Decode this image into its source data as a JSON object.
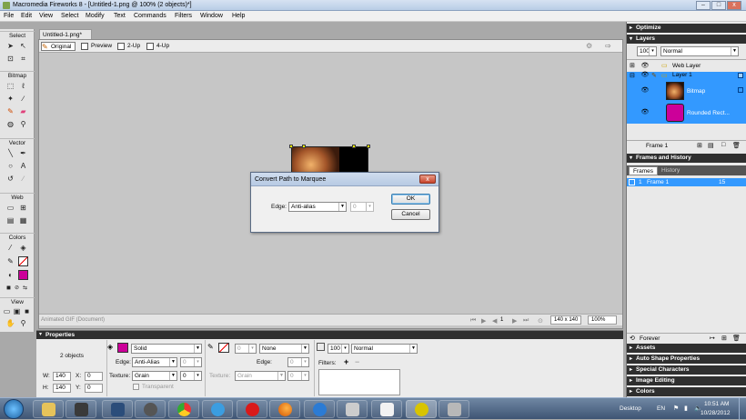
{
  "window": {
    "title": "Macromedia Fireworks 8 - [Untitled-1.png @ 100% (2 objects)*]"
  },
  "menu": [
    "File",
    "Edit",
    "View",
    "Select",
    "Modify",
    "Text",
    "Commands",
    "Filters",
    "Window",
    "Help"
  ],
  "tools": {
    "sections": [
      "Select",
      "Bitmap",
      "Vector",
      "Web",
      "Colors",
      "View"
    ]
  },
  "document": {
    "tab": "Untitled-1.png*",
    "views": [
      "Original",
      "Preview",
      "2-Up",
      "4-Up"
    ],
    "status_left": "Animated GIF (Document)",
    "frame_num": "1",
    "dimensions": "140 x 140",
    "zoom": "100%"
  },
  "dialog": {
    "title": "Convert Path to Marquee",
    "edge_label": "Edge:",
    "edge_value": "Anti-alias",
    "edge_amount": "0",
    "ok": "OK",
    "cancel": "Cancel"
  },
  "properties": {
    "header": "Properties",
    "objects": "2 objects",
    "fill_type": "Solid",
    "edge_label": "Edge:",
    "edge_value": "Anti-Alias",
    "edge_num": "0",
    "texture_label": "Texture:",
    "texture_value": "Grain",
    "texture_num": "0",
    "transparent": "Transparent",
    "stroke_num": "0",
    "stroke_type": "None",
    "stroke_edge_label": "Edge:",
    "stroke_edge_num": "0",
    "stroke_texture_label": "Texture:",
    "stroke_texture_value": "Grain",
    "stroke_texture_num": "0",
    "opacity": "100",
    "blend": "Normal",
    "filters_label": "Filters:",
    "w_label": "W:",
    "w": "140",
    "x_label": "X:",
    "x": "0",
    "h_label": "H:",
    "h": "140",
    "y_label": "Y:",
    "y": "0",
    "fill_color": "#cc0099"
  },
  "panels": {
    "optimize": "Optimize",
    "layers": "Layers",
    "layer_opacity": "100",
    "layer_blend": "Normal",
    "web_layer": "Web Layer",
    "layer1": "Layer 1",
    "bitmap": "Bitmap",
    "rounded": "Rounded Rect...",
    "frame_label": "Frame 1",
    "frames_history": "Frames and History",
    "frames_tab": "Frames",
    "history_tab": "History",
    "frame_row": "1",
    "frame_row_name": "Frame 1",
    "frame_delay": "15",
    "loop": "Forever",
    "assets": "Assets",
    "auto_shape": "Auto Shape Properties",
    "special_chars": "Special Characters",
    "image_editing": "Image Editing",
    "colors": "Colors"
  },
  "taskbar": {
    "desktop": "Desktop",
    "lang": "EN",
    "time": "10:51 AM",
    "date": "10/28/2012"
  },
  "colors": {
    "accent": "#3399ff",
    "selected_row": "#3399ff",
    "magenta": "#cc0099"
  }
}
